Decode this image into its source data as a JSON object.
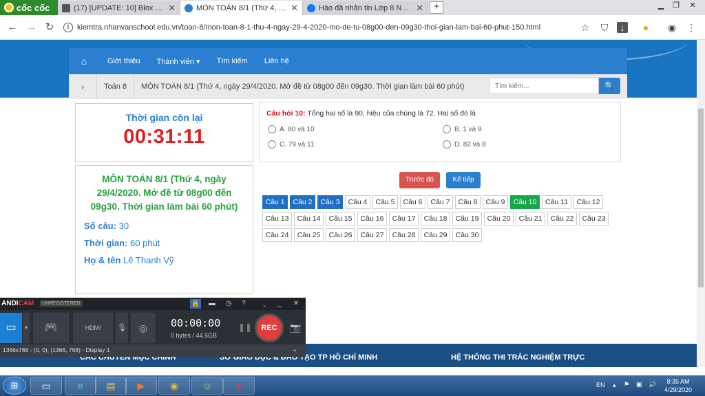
{
  "browser": {
    "brand": "cốc cốc",
    "tabs": [
      {
        "label": "(17) [UPDATE: 10] Blox Fruits",
        "color": "#555"
      },
      {
        "label": "MÔN TOÁN 8/1 (Thứ 4, ngày",
        "color": "#2a7fd0"
      },
      {
        "label": "Hào đã nhắn tin Lớp 8 Nhân",
        "color": "#1877f2"
      }
    ],
    "url": "kiemtra.nhanvanschool.edu.vn/toan-8/mon-toan-8-1-thu-4-ngay-29-4-2020-mo-de-tu-08g00-den-09g30-thoi-gian-lam-bai-60-phut-150.html"
  },
  "nav": {
    "items": [
      "Giới thiệu",
      "Thành viên ▾",
      "Tìm kiếm",
      "Liên hệ"
    ]
  },
  "breadcrumb": {
    "items": [
      "Toán 8",
      "MÔN TOÁN 8/1 (Thứ 4, ngày 29/4/2020. Mở đề từ 08g00 đến 09g30. Thời gian làm bài 60 phút)"
    ]
  },
  "search": {
    "placeholder": "Tìm kiếm..."
  },
  "timer": {
    "label": "Thời gian còn lại",
    "value": "00:31:11"
  },
  "exam": {
    "title": "MÔN TOÁN 8/1 (Thứ 4, ngày 29/4/2020. Mở đề từ 08g00 đến 09g30. Thời gian làm bài 60 phút)",
    "count_label": "Số câu:",
    "count_value": "30",
    "time_label": "Thời gian:",
    "time_value": "60 phút",
    "name_label": "Họ & tên",
    "name_value": "Lê Thanh Vỹ"
  },
  "question": {
    "number": "Câu hỏi 10:",
    "text": "Tổng hai số là 90, hiệu của chúng là 72. Hai số đó là",
    "options": [
      "A. 80 và 10",
      "B. 1 và 9",
      "C. 79 và 11",
      "D. 82 và 8"
    ]
  },
  "buttons": {
    "prev": "Trước đó",
    "next": "Kế tiếp"
  },
  "questions": {
    "labels": [
      "Câu 1",
      "Câu 2",
      "Câu 3",
      "Câu 4",
      "Câu 5",
      "Câu 6",
      "Câu 7",
      "Câu 8",
      "Câu 9",
      "Câu 10",
      "Câu 11",
      "Câu 12",
      "Câu 13",
      "Câu 14",
      "Câu 15",
      "Câu 16",
      "Câu 17",
      "Câu 18",
      "Câu 19",
      "Câu 20",
      "Câu 21",
      "Câu 22",
      "Câu 23",
      "Câu 24",
      "Câu 25",
      "Câu 26",
      "Câu 27",
      "Câu 28",
      "Câu 29",
      "Câu 30"
    ],
    "answered": [
      1,
      2,
      3
    ],
    "current": 10
  },
  "footer": {
    "headings": [
      "CÁC CHUYÊN MỤC CHÍNH",
      "SỞ GIÁO DỤC & ĐÀO TẠO TP HỒ CHÍ MINH",
      "HỆ THỐNG THI TRẮC NGHIỆM TRỰC"
    ]
  },
  "bandicam": {
    "logo_a": "ANDI",
    "logo_b": "CAM",
    "unregistered": "UNREGISTERED",
    "timer": "00:00:00",
    "size": "0 bytes / 44.5GB",
    "rec": "REC",
    "status": "1366x768 - (0, 0), (1366, 768) - Display 1"
  },
  "taskbar": {
    "lang": "EN",
    "time": "8:35 AM",
    "date": "4/29/2020"
  }
}
